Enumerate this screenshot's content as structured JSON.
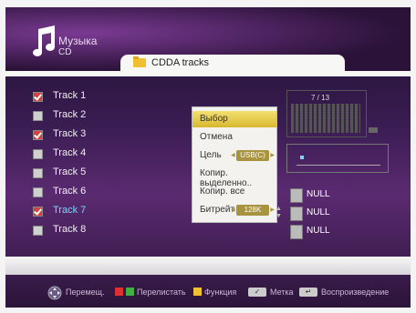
{
  "header": {
    "title": "Музыка",
    "subtitle": "CD"
  },
  "tab": {
    "label": "CDDA tracks"
  },
  "tracks": [
    {
      "label": "Track 1",
      "checked": true
    },
    {
      "label": "Track 2",
      "checked": false
    },
    {
      "label": "Track 3",
      "checked": true
    },
    {
      "label": "Track 4",
      "checked": false
    },
    {
      "label": "Track 5",
      "checked": false
    },
    {
      "label": "Track 6",
      "checked": false
    },
    {
      "label": "Track 7",
      "checked": true,
      "active": true
    },
    {
      "label": "Track 8",
      "checked": false
    }
  ],
  "menu": {
    "items": [
      {
        "label": "Выбор",
        "selected": true
      },
      {
        "label": "Отмена"
      },
      {
        "label": "Цель",
        "value": "USB(C)"
      },
      {
        "label": "Копир. выделенно.."
      },
      {
        "label": "Копир. все"
      },
      {
        "label": "Битрейт",
        "value": "128K"
      }
    ]
  },
  "player": {
    "track_counter": "7 / 13"
  },
  "info": [
    {
      "icon": "note-icon",
      "text": "NULL"
    },
    {
      "icon": "person-icon",
      "text": "NULL"
    },
    {
      "icon": "disc-icon",
      "text": "NULL"
    }
  ],
  "footer": {
    "move": "Перемещ.",
    "scroll": "Перелистать",
    "function": "Функция",
    "mark": "Метка",
    "play": "Воспроизведение"
  },
  "colors": {
    "accent": "#7ad4ff",
    "checked": "#d84040",
    "selected": "#e8c840",
    "footer_red": "#e03030",
    "footer_green": "#40b040",
    "footer_yellow": "#f0c030"
  }
}
